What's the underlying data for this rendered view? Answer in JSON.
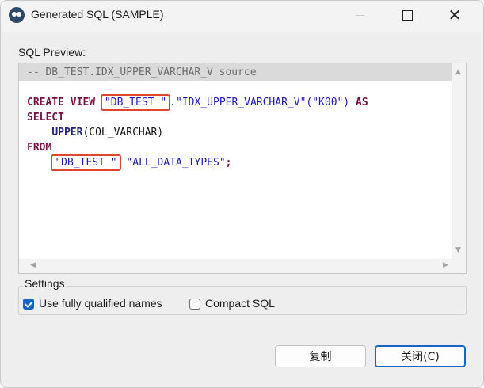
{
  "window": {
    "title": "Generated SQL (SAMPLE)",
    "icon": "app-logo-icon"
  },
  "titlebar_buttons": {
    "minimize_icon": "minimize-icon",
    "maximize_icon": "maximize-icon",
    "close_glyph": "✕"
  },
  "preview": {
    "label": "SQL Preview:",
    "lines": {
      "comment": "-- DB_TEST.IDX_UPPER_VARCHAR_V source",
      "l2_kw": "CREATE VIEW ",
      "l2_schema": "\"DB_TEST \"",
      "l2_dot": ".",
      "l2_view": "\"IDX_UPPER_VARCHAR_V\"(\"K00\")",
      "l2_as": " AS",
      "l3_kw": "SELECT",
      "l4_indent": "    ",
      "l4_fn": "UPPER",
      "l4_rest": "(COL_VARCHAR)",
      "l5_kw": "FROM",
      "l6_indent": "    ",
      "l6_schema": "\"DB_TEST \"",
      "l6_table": " \"ALL_DATA_TYPES\"",
      "l6_semi": ";"
    }
  },
  "settings": {
    "label": "Settings",
    "fully_qualified": {
      "label": "Use fully qualified names",
      "checked": true
    },
    "compact_sql": {
      "label": "Compact SQL",
      "checked": false
    }
  },
  "buttons": {
    "copy": "复制",
    "close": "关闭(C)"
  },
  "colors": {
    "highlight_box": "#e0452f",
    "checkbox_accent": "#1764c4"
  }
}
